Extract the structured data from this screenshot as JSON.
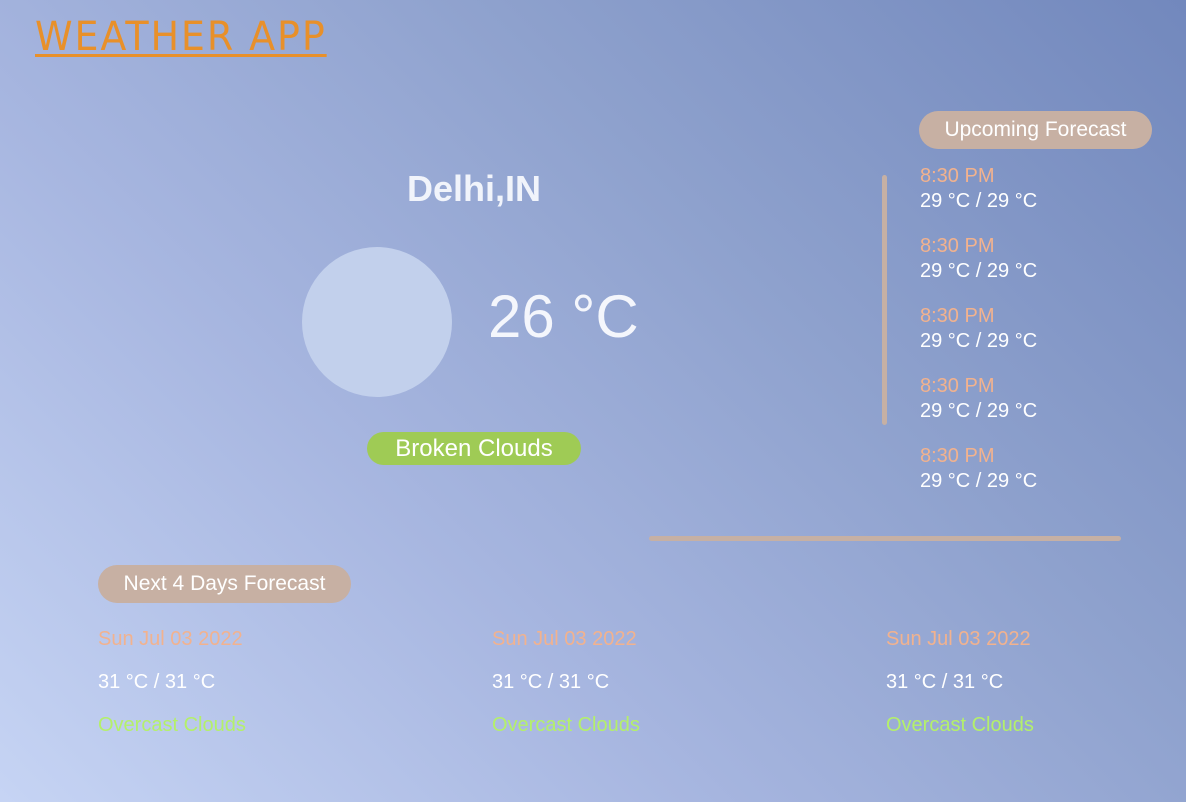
{
  "app": {
    "title": "WEATHER APP"
  },
  "current": {
    "city": "Delhi,IN",
    "temperature": "26 °C",
    "description": "Broken Clouds",
    "icon": "weather-icon"
  },
  "upcoming": {
    "title": "Upcoming Forecast",
    "items": [
      {
        "time": "8:30 PM",
        "range": "29 °C / 29 °C"
      },
      {
        "time": "8:30 PM",
        "range": "29 °C / 29 °C"
      },
      {
        "time": "8:30 PM",
        "range": "29 °C / 29 °C"
      },
      {
        "time": "8:30 PM",
        "range": "29 °C / 29 °C"
      },
      {
        "time": "8:30 PM",
        "range": "29 °C / 29 °C"
      }
    ]
  },
  "next_days": {
    "title": "Next 4 Days Forecast",
    "items": [
      {
        "date": "Sun Jul 03 2022",
        "range": "31 °C / 31 °C",
        "description": "Overcast Clouds"
      },
      {
        "date": "Sun Jul 03 2022",
        "range": "31 °C / 31 °C",
        "description": "Overcast Clouds"
      },
      {
        "date": "Sun Jul 03 2022",
        "range": "31 °C / 31 °C",
        "description": "Overcast Clouds"
      }
    ]
  },
  "colors": {
    "title": "#e8902a",
    "pill": "#c7b0a3",
    "description_pill": "#9fcb55",
    "time_text": "#f2b28e",
    "day_description": "#b4f06a"
  }
}
